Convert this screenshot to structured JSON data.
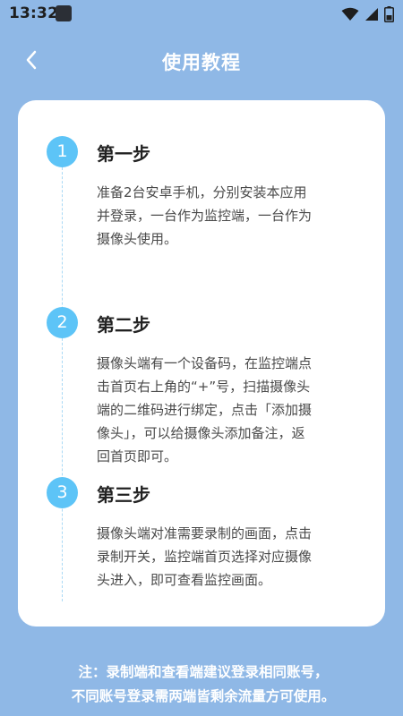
{
  "status_bar": {
    "time": "13:32",
    "icons": [
      "app-icon",
      "wifi-icon",
      "signal-icon",
      "battery-icon"
    ]
  },
  "header": {
    "back_icon": "chevron-left-icon",
    "title": "使用教程"
  },
  "steps": [
    {
      "number": "1",
      "title": "第一步",
      "lines": [
        "准备2台安卓手机，分别安装本应用",
        "并登录，一台作为监控端，一台作为",
        "摄像头使用。"
      ]
    },
    {
      "number": "2",
      "title": "第二步",
      "lines": [
        "摄像头端有一个设备码，在监控端点",
        "击首页右上角的“+”号，扫描摄像头",
        "端的二维码进行绑定，点击「添加摄",
        "像头」，可以给摄像头添加备注，返",
        "回首页即可。"
      ]
    },
    {
      "number": "3",
      "title": "第三步",
      "lines": [
        "摄像头端对准需要录制的画面，点击",
        "录制开关，监控端首页选择对应摄像",
        "头进入，即可查看监控画面。"
      ]
    }
  ],
  "footer": {
    "line1": "注：录制端和查看端建议登录相同账号，",
    "line2": "不同账号登录需两端皆剩余流量方可使用。"
  },
  "colors": {
    "background": "#8fb8e6",
    "accent": "#5dc4f7",
    "card": "#ffffff"
  }
}
